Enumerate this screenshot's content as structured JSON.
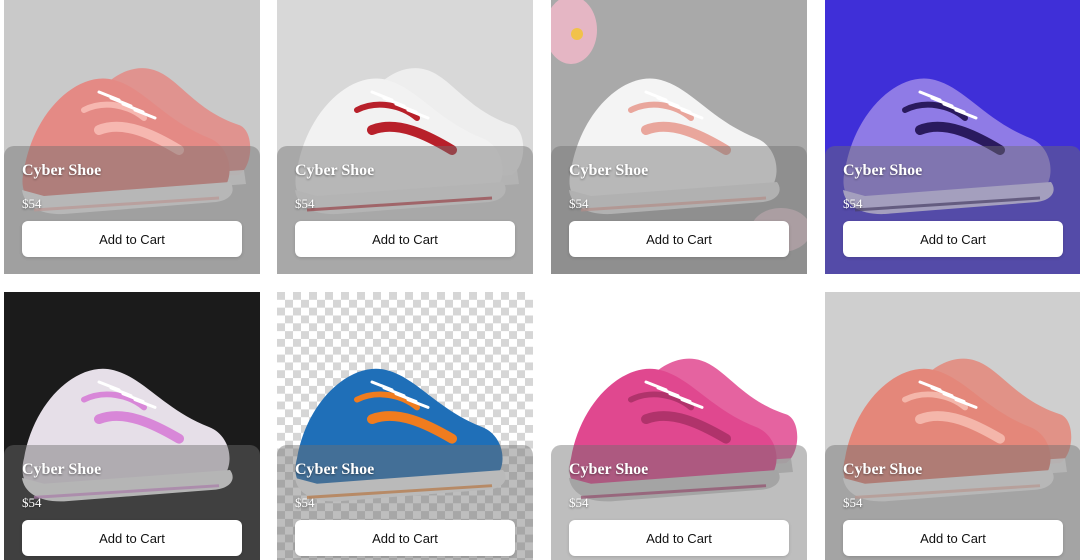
{
  "products": [
    {
      "title": "Cyber Shoe",
      "price": "$54",
      "button": "Add to Cart"
    },
    {
      "title": "Cyber Shoe",
      "price": "$54",
      "button": "Add to Cart"
    },
    {
      "title": "Cyber Shoe",
      "price": "$54",
      "button": "Add to Cart"
    },
    {
      "title": "Cyber Shoe",
      "price": "$54",
      "button": "Add to Cart"
    },
    {
      "title": "Cyber Shoe",
      "price": "$54",
      "button": "Add to Cart"
    },
    {
      "title": "Cyber Shoe",
      "price": "$54",
      "button": "Add to Cart"
    },
    {
      "title": "Cyber Shoe",
      "price": "$54",
      "button": "Add to Cart"
    },
    {
      "title": "Cyber Shoe",
      "price": "$54",
      "button": "Add to Cart"
    }
  ],
  "images": [
    {
      "name": "pink-velcro-sneakers",
      "bg": "#c9c9c9",
      "shoe": "#e48a85",
      "accent": "#f6b7b0",
      "sole": "#f3f3f3"
    },
    {
      "name": "white-red-stripe-sneakers",
      "bg": "#d8d8d8",
      "shoe": "#f2f2f2",
      "accent": "#b8202a",
      "sole": "#ededed"
    },
    {
      "name": "white-pink-swoosh-sneaker",
      "bg": "#a9a9a9",
      "shoe": "#f4f4f4",
      "accent": "#e9a69c",
      "sole": "#e8e8e8"
    },
    {
      "name": "purple-chrome-sneaker",
      "bg": "#3f2fd8",
      "shoe": "#8f7be6",
      "accent": "#2a1a5e",
      "sole": "#d0c6ff"
    },
    {
      "name": "iridescent-sneaker",
      "bg": "#1b1b1b",
      "shoe": "#e6dfe8",
      "accent": "#d887d8",
      "sole": "#efefef"
    },
    {
      "name": "blue-orange-running-shoe",
      "bg": "#eeeeee",
      "shoe": "#1f6fb8",
      "accent": "#f07c1e",
      "sole": "#f7f7f7"
    },
    {
      "name": "magenta-sneakers",
      "bg": "#ffffff",
      "shoe": "#e0488f",
      "accent": "#b0336b",
      "sole": "#cfcfcf"
    },
    {
      "name": "coral-velcro-sneakers",
      "bg": "#cfcfcf",
      "shoe": "#e4877a",
      "accent": "#f4b6aa",
      "sole": "#f2f2f2"
    }
  ]
}
